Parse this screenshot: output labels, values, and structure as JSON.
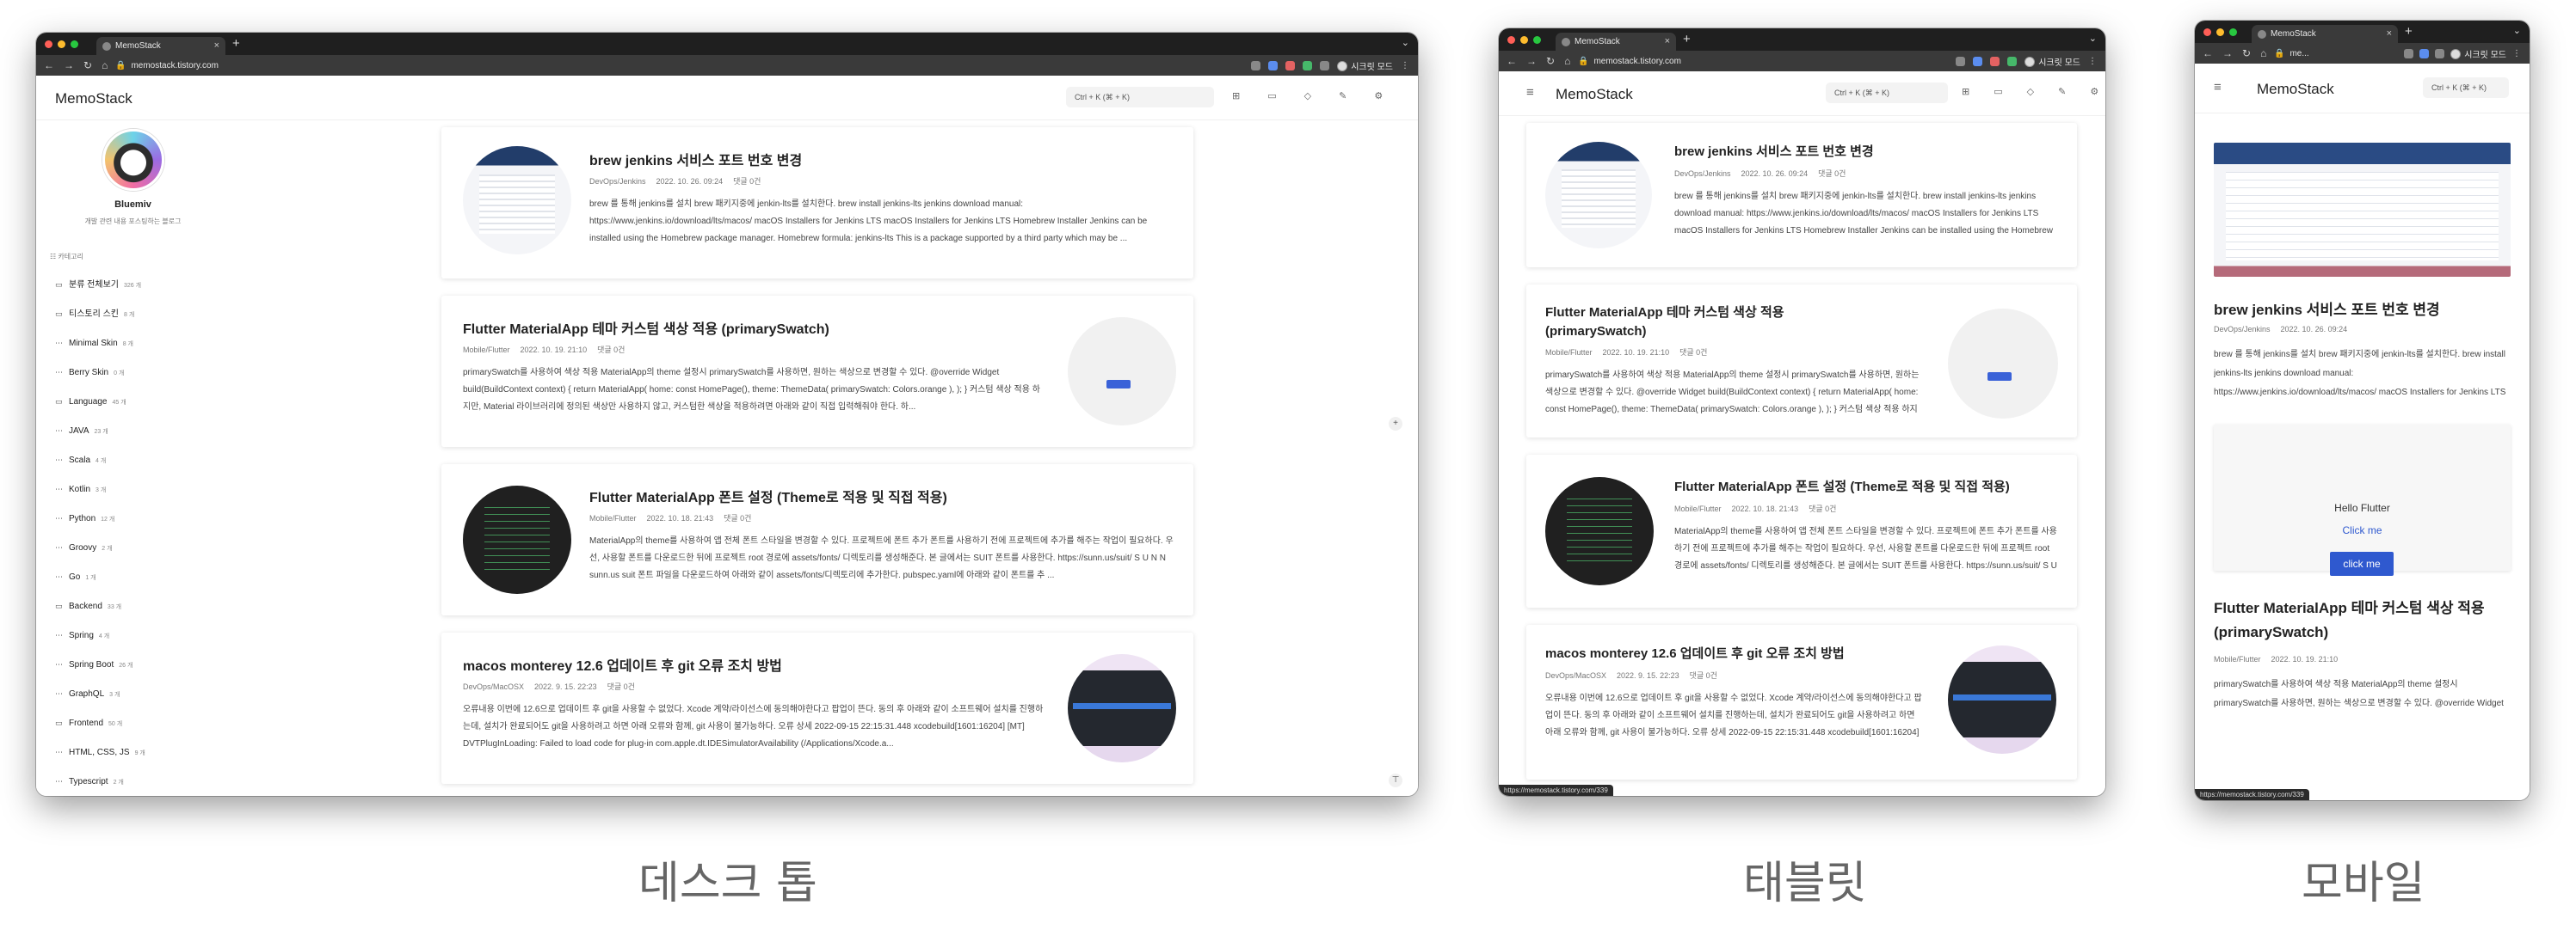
{
  "browser": {
    "tab_title": "MemoStack",
    "url": "memostack.tistory.com",
    "url_short": "me...",
    "profile_label": "시크릿 모드",
    "status_url": "https://memostack.tistory.com/339"
  },
  "blog": {
    "logo": "MemoStack",
    "search_placeholder": "Ctrl + K (⌘ + K)",
    "blogger_name": "Bluemiv",
    "blog_description": "개발 관련 내용 포스팅하는 블로그",
    "category_heading": "카테고리"
  },
  "categories": [
    {
      "label": "분류 전체보기",
      "count": "326 개",
      "icon": "folder-icon"
    },
    {
      "label": "티스토리 스킨",
      "count": "8 개",
      "icon": "folder-icon"
    },
    {
      "label": "Minimal Skin",
      "count": "8 개",
      "icon": "dash-icon"
    },
    {
      "label": "Berry Skin",
      "count": "0 개",
      "icon": "dash-icon"
    },
    {
      "label": "Language",
      "count": "45 개",
      "icon": "folder-icon"
    },
    {
      "label": "JAVA",
      "count": "23 개",
      "icon": "dash-icon"
    },
    {
      "label": "Scala",
      "count": "4 개",
      "icon": "dash-icon"
    },
    {
      "label": "Kotlin",
      "count": "3 개",
      "icon": "dash-icon"
    },
    {
      "label": "Python",
      "count": "12 개",
      "icon": "dash-icon"
    },
    {
      "label": "Groovy",
      "count": "2 개",
      "icon": "dash-icon"
    },
    {
      "label": "Go",
      "count": "1 개",
      "icon": "dash-icon"
    },
    {
      "label": "Backend",
      "count": "33 개",
      "icon": "folder-icon"
    },
    {
      "label": "Spring",
      "count": "4 개",
      "icon": "dash-icon"
    },
    {
      "label": "Spring Boot",
      "count": "26 개",
      "icon": "dash-icon"
    },
    {
      "label": "GraphQL",
      "count": "3 개",
      "icon": "dash-icon"
    },
    {
      "label": "Frontend",
      "count": "50 개",
      "icon": "folder-icon"
    },
    {
      "label": "HTML, CSS, JS",
      "count": "9 개",
      "icon": "dash-icon"
    },
    {
      "label": "Typescript",
      "count": "2 개",
      "icon": "dash-icon"
    }
  ],
  "posts": [
    {
      "title": "brew jenkins 서비스 포트 번호 변경",
      "category": "DevOps/Jenkins",
      "date": "2022. 10. 26. 09:24",
      "comments": "댓글 0건",
      "excerpt": "brew 를 통해 jenkins를 설치 brew 패키지중에 jenkin-lts를 설치한다. brew install jenkins-lts jenkins download manual: https://www.jenkins.io/download/lts/macos/ macOS Installers for Jenkins LTS macOS Installers for Jenkins LTS Homebrew Installer Jenkins can be installed using the Homebrew package manager. Homebrew formula: jenkins-lts This is a package supported by a third party which may be ...",
      "thumb": "jenkins-thumbnail"
    },
    {
      "title": "Flutter MaterialApp 테마 커스텀 색상 적용 (primarySwatch)",
      "category": "Mobile/Flutter",
      "date": "2022. 10. 19. 21:10",
      "comments": "댓글 0건",
      "excerpt": "primarySwatch를 사용하여 색상 적용 MaterialApp의 theme 설정시 primarySwatch를 사용하면, 원하는 색상으로 변경할 수 있다. @override Widget build(BuildContext context) { return MaterialApp( home: const HomePage(), theme: ThemeData( primarySwatch: Colors.orange ), ); } 커스텀 색상 적용 하지만, Material 라이브러리에 정의된 색상만 사용하지 않고, 커스텀한 색상을 적용하려면 아래와 같이 직접 입력해줘야 한다. 하...",
      "thumb": "flutter-thumbnail"
    },
    {
      "title": "Flutter MaterialApp 폰트 설정 (Theme로 적용 및 직접 적용)",
      "category": "Mobile/Flutter",
      "date": "2022. 10. 18. 21:43",
      "comments": "댓글 0건",
      "excerpt": "MaterialApp의 theme를 사용하여 앱 전체 폰트 스타일을 변경할 수 있다. 프로젝트에 폰트 추가 폰트를 사용하기 전에 프로젝트에 추가를 해주는 작업이 필요하다. 우선, 사용할 폰트를 다운로드한 뒤에 프로젝트 root 경로에 assets/fonts/ 디렉토리를 생성해준다. 본 글에서는 SUIT 폰트를 사용한다. https://sunn.us/suit/ S U N N sunn.us suit 폰트 파일을 다운로드하여 아래와 같이 assets/fonts/디렉토리에 추가한다. pubspec.yaml에 아래와 같이 폰트를 추 ...",
      "thumb": "fonts-thumbnail"
    },
    {
      "title": "macos monterey 12.6 업데이트 후 git 오류 조치 방법",
      "category": "DevOps/MacOSX",
      "date": "2022. 9. 15. 22:23",
      "comments": "댓글 0건",
      "excerpt": "오류내용 이번에 12.6으로 업데이트 후 git을 사용할 수 없었다. Xcode 계약/라이선스에 동의해야한다고 팝업이 뜬다. 동의 후 아래와 같이 소프트웨어 설치를 진행하는데, 설치가 완료되어도 git을 사용하려고 하면 아래 오류와 함께, git 사용이 불가능하다. 오류 상세 2022-09-15 22:15:31.448 xcodebuild[1601:16204] [MT] DVTPlugInLoading: Failed to load code for plug-in com.apple.dt.IDESimulatorAvailability (/Applications/Xcode.a...",
      "thumb": "macos-thumbnail"
    }
  ],
  "flutter_demo": {
    "title": "Hello Flutter",
    "link": "Click me",
    "button": "click me"
  },
  "captions": {
    "desktop": "데스크 톱",
    "tablet": "태블릿",
    "mobile": "모바일"
  },
  "colors": {
    "link_blue": "#2f59cf",
    "window_chrome": "#1f1f1f"
  }
}
